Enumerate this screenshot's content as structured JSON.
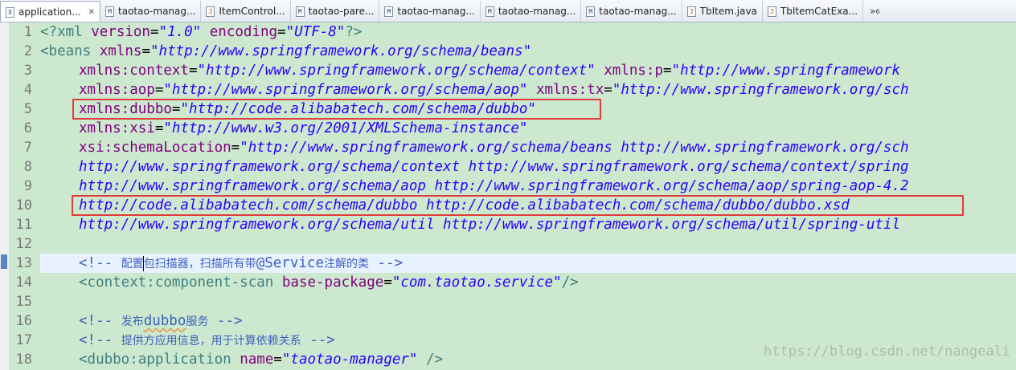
{
  "tabs": [
    {
      "label": "application...",
      "icon": "xml-file-icon",
      "active": true,
      "closable": true
    },
    {
      "label": "taotao-manag...",
      "icon": "maven-pom-icon"
    },
    {
      "label": "ItemControl...",
      "icon": "java-file-icon"
    },
    {
      "label": "taotao-pare...",
      "icon": "maven-pom-icon"
    },
    {
      "label": "taotao-manag...",
      "icon": "maven-pom-icon"
    },
    {
      "label": "taotao-manag...",
      "icon": "maven-pom-icon"
    },
    {
      "label": "taotao-manag...",
      "icon": "maven-pom-icon"
    },
    {
      "label": "TbItem.java",
      "icon": "java-file-icon"
    },
    {
      "label": "TbItemCatExa...",
      "icon": "java-file-icon"
    }
  ],
  "overflow": {
    "symbol": "»",
    "count": "6"
  },
  "tab_close_symbol": "✕",
  "editor": {
    "line_numbers": [
      "1",
      "2",
      "3",
      "4",
      "5",
      "6",
      "7",
      "8",
      "9",
      "10",
      "11",
      "12",
      "13",
      "14",
      "15",
      "16",
      "17",
      "18"
    ],
    "current_line": "13",
    "lines": {
      "l1": {
        "a": "<?xml ",
        "b": "version",
        "c": "=",
        "d": "\"1.0\"",
        "e": " encoding",
        "f": "=",
        "g": "\"UTF-8\"",
        "h": "?>"
      },
      "l2": {
        "a": "<beans ",
        "b": "xmlns",
        "c": "=",
        "d": "\"http://www.springframework.org/schema/beans\""
      },
      "l3": {
        "b": "xmlns:context",
        "c": "=",
        "d": "\"http://www.springframework.org/schema/context\"",
        "e": " xmlns:p",
        "f": "=",
        "g": "\"http://www.springframework"
      },
      "l4": {
        "b": "xmlns:aop",
        "c": "=",
        "d": "\"http://www.springframework.org/schema/aop\"",
        "e": " xmlns:tx",
        "f": "=",
        "g": "\"http://www.springframework.org/sch"
      },
      "l5": {
        "b": "xmlns:dubbo",
        "c": "=",
        "d": "\"http://code.alibabatech.com/schema/dubbo\""
      },
      "l6": {
        "b": "xmlns:xsi",
        "c": "=",
        "d": "\"http://www.w3.org/2001/XMLSchema-instance\""
      },
      "l7": {
        "b": "xsi:schemaLocation",
        "c": "=",
        "d": "\"http://www.springframework.org/schema/beans http://www.springframework.org/sch"
      },
      "l8": {
        "d": "http://www.springframework.org/schema/context http://www.springframework.org/schema/context/spring"
      },
      "l9": {
        "d": "http://www.springframework.org/schema/aop http://www.springframework.org/schema/aop/spring-aop-4.2"
      },
      "l10": {
        "d": "http://code.alibabatech.com/schema/dubbo http://code.alibabatech.com/schema/dubbo/dubbo.xsd"
      },
      "l11": {
        "d": "http://www.springframework.org/schema/util http://www.springframework.org/schema/util/spring-util"
      },
      "l13": {
        "open": "<!-- ",
        "t1": "配置",
        "t2": "包扫描器，扫描所有带",
        "t3": "@Service",
        "t4": "注解的类",
        "close": " -->"
      },
      "l14": {
        "a": "<context:component-scan ",
        "b": "base-package",
        "c": "=",
        "d": "\"com.taotao.service\"",
        "h": "/>"
      },
      "l16": {
        "open": "<!-- ",
        "t1": "发布",
        "t2": "dubbo",
        "t3": "服务",
        "close": " -->"
      },
      "l17": {
        "open": "<!-- ",
        "t1": "提供方应用信息，用于计算依赖关系",
        "close": " -->"
      },
      "l18": {
        "a": "<dubbo:application ",
        "b": "name",
        "c": "=",
        "d": "\"taotao-manager\"",
        "h": " />"
      }
    }
  },
  "watermark": "https://blog.csdn.net/nangeali",
  "colors": {
    "editor_background": "#cce8cf",
    "tag": "#3f7f7f",
    "attribute": "#7f007f",
    "string": "#2a00ff",
    "comment": "#3f5fbf",
    "highlight_box": "#e03c3c"
  }
}
